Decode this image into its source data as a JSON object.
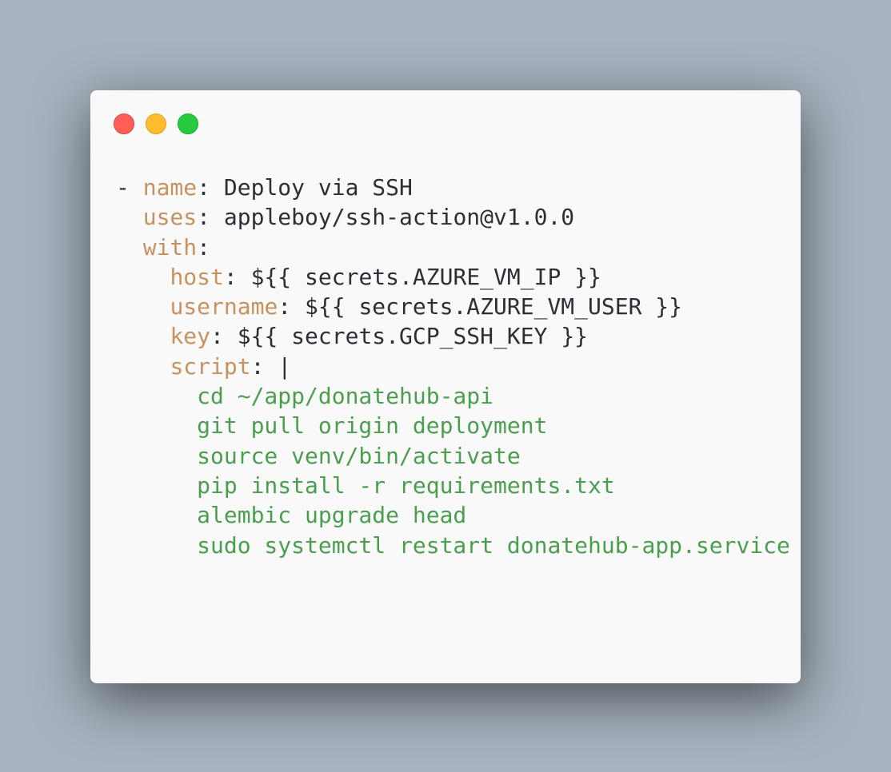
{
  "window": {
    "controls": [
      {
        "name": "close",
        "color": "#ff5f56"
      },
      {
        "name": "minimize",
        "color": "#ffbd2e"
      },
      {
        "name": "maximize",
        "color": "#27c93f"
      }
    ]
  },
  "code": {
    "colors": {
      "key": "#c7925f",
      "text": "#2b2f36",
      "script": "#4c9e4f",
      "background": "#f9f9f9",
      "desktop": "#a7b2be"
    },
    "lines": {
      "l1": {
        "prefix": "- ",
        "key": "name",
        "sep": ": ",
        "value": "Deploy via SSH"
      },
      "l2": {
        "indent": "  ",
        "key": "uses",
        "sep": ": ",
        "value": "appleboy/ssh-action@v1.0.0"
      },
      "l3": {
        "indent": "  ",
        "key": "with",
        "sep": ":"
      },
      "l4": {
        "indent": "    ",
        "key": "host",
        "sep": ": ",
        "value": "${{ secrets.AZURE_VM_IP }}"
      },
      "l5": {
        "indent": "    ",
        "key": "username",
        "sep": ": ",
        "value": "${{ secrets.AZURE_VM_USER }}"
      },
      "l6": {
        "indent": "    ",
        "key": "key",
        "sep": ": ",
        "value": "${{ secrets.GCP_SSH_KEY }}"
      },
      "l7": {
        "indent": "    ",
        "key": "script",
        "sep": ": ",
        "value": "|"
      }
    },
    "script": [
      "      cd ~/app/donatehub-api",
      "      git pull origin deployment",
      "      source venv/bin/activate",
      "      pip install -r requirements.txt",
      "      alembic upgrade head",
      "      sudo systemctl restart donatehub-app.service"
    ]
  }
}
